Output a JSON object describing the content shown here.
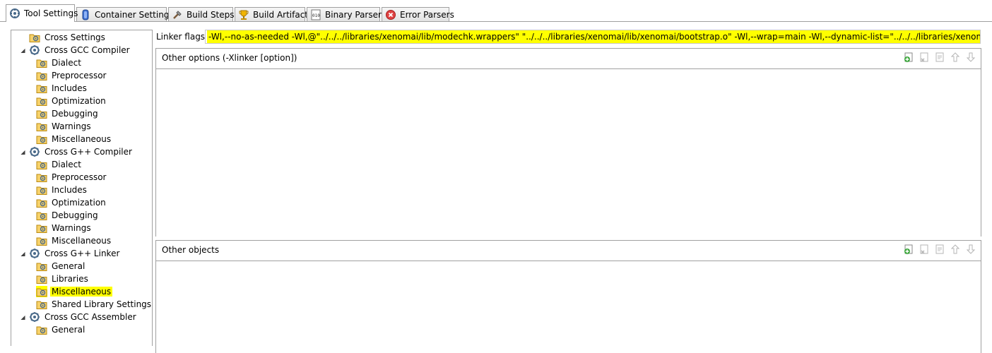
{
  "tabs": [
    {
      "label": "Tool Settings",
      "icon": "tool-settings-icon",
      "active": true
    },
    {
      "label": "Container Settings",
      "icon": "container-icon",
      "active": false
    },
    {
      "label": "Build Steps",
      "icon": "build-steps-icon",
      "active": false
    },
    {
      "label": "Build Artifact",
      "icon": "artifact-trophy-icon",
      "active": false
    },
    {
      "label": "Binary Parsers",
      "icon": "binary-parser-icon",
      "active": false
    },
    {
      "label": "Error Parsers",
      "icon": "error-parser-icon",
      "active": false
    }
  ],
  "tree": [
    {
      "label": "Cross Settings",
      "level": 0,
      "expander": "",
      "icon": "settings-folder-icon"
    },
    {
      "label": "Cross GCC Compiler",
      "level": 0,
      "expander": "◢",
      "icon": "tool-gear-icon"
    },
    {
      "label": "Dialect",
      "level": 1,
      "icon": "settings-folder-icon"
    },
    {
      "label": "Preprocessor",
      "level": 1,
      "icon": "settings-folder-icon"
    },
    {
      "label": "Includes",
      "level": 1,
      "icon": "settings-folder-icon"
    },
    {
      "label": "Optimization",
      "level": 1,
      "icon": "settings-folder-icon"
    },
    {
      "label": "Debugging",
      "level": 1,
      "icon": "settings-folder-icon"
    },
    {
      "label": "Warnings",
      "level": 1,
      "icon": "settings-folder-icon"
    },
    {
      "label": "Miscellaneous",
      "level": 1,
      "icon": "settings-folder-icon"
    },
    {
      "label": "Cross G++ Compiler",
      "level": 0,
      "expander": "◢",
      "icon": "tool-gear-icon"
    },
    {
      "label": "Dialect",
      "level": 1,
      "icon": "settings-folder-icon"
    },
    {
      "label": "Preprocessor",
      "level": 1,
      "icon": "settings-folder-icon"
    },
    {
      "label": "Includes",
      "level": 1,
      "icon": "settings-folder-icon"
    },
    {
      "label": "Optimization",
      "level": 1,
      "icon": "settings-folder-icon"
    },
    {
      "label": "Debugging",
      "level": 1,
      "icon": "settings-folder-icon"
    },
    {
      "label": "Warnings",
      "level": 1,
      "icon": "settings-folder-icon"
    },
    {
      "label": "Miscellaneous",
      "level": 1,
      "icon": "settings-folder-icon"
    },
    {
      "label": "Cross G++ Linker",
      "level": 0,
      "expander": "◢",
      "icon": "tool-gear-icon"
    },
    {
      "label": "General",
      "level": 1,
      "icon": "settings-folder-icon"
    },
    {
      "label": "Libraries",
      "level": 1,
      "icon": "settings-folder-icon"
    },
    {
      "label": "Miscellaneous",
      "level": 1,
      "icon": "settings-folder-icon",
      "selected": true
    },
    {
      "label": "Shared Library Settings",
      "level": 1,
      "icon": "settings-folder-icon"
    },
    {
      "label": "Cross GCC Assembler",
      "level": 0,
      "expander": "◢",
      "icon": "tool-gear-icon"
    },
    {
      "label": "General",
      "level": 1,
      "icon": "settings-folder-icon"
    }
  ],
  "linker": {
    "flags_label": "Linker flags",
    "flags_value": "-Wl,--no-as-needed -Wl,@\"../../../libraries/xenomai/lib/modechk.wrappers\" \"../../../libraries/xenomai/lib/xenomai/bootstrap.o\" -Wl,--wrap=main -Wl,--dynamic-list=\"../../../libraries/xenomai/lib/dynlist.ld\""
  },
  "groups": {
    "other_options": {
      "title": "Other options (-Xlinker [option])"
    },
    "other_objects": {
      "title": "Other objects"
    }
  },
  "group_tools": [
    "add-icon",
    "delete-icon",
    "edit-icon",
    "move-up-icon",
    "move-down-icon"
  ],
  "colors": {
    "highlight": "#ffff00",
    "border": "#a0a0a0"
  }
}
